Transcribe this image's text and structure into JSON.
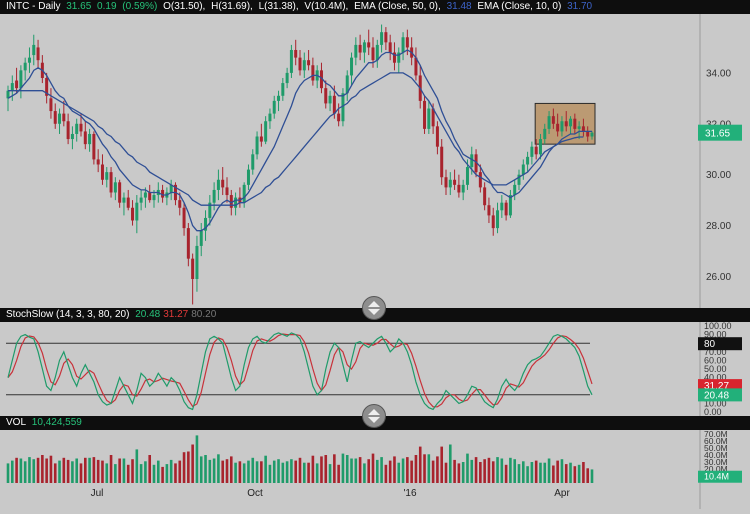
{
  "header": {
    "symbol": "INTC - Daily",
    "last": "31.65",
    "change": "0.19",
    "change_pct": "(0.59%)",
    "open": "O(31.50),",
    "high": "H(31.69),",
    "low": "L(31.38),",
    "volume": "V(10.4M),",
    "ema50_label": "EMA (Close, 50, 0),",
    "ema50_value": "31.48",
    "ema10_label": "EMA (Close, 10, 0)",
    "ema10_value": "31.70"
  },
  "stoch_header": {
    "label": "StochSlow (14, 3, 3, 80, 20)",
    "k_value": "20.48",
    "d_value": "31.27",
    "level_value": "80.20"
  },
  "vol_header": {
    "label": "VOL",
    "value": "10,424,559"
  },
  "colors": {
    "background": "#c9c9c9",
    "up_candle": "#1f9b6a",
    "down_candle": "#a8232d",
    "ema": "#2f4f95",
    "highlight": "#b58a55",
    "stoch_k": "#1f9b6a",
    "stoch_d": "#c8323a",
    "price_badge": "#22b07a",
    "d_badge": "#d8242e"
  },
  "price_axis": {
    "ticks": [
      "34.00",
      "32.00",
      "30.00",
      "28.00",
      "26.00"
    ],
    "badge": "31.65"
  },
  "stoch_axis": {
    "ticks": [
      "100.00",
      "90.00",
      "80.00",
      "70.00",
      "60.00",
      "50.00",
      "40.00",
      "30.00",
      "20.00",
      "10.00",
      "0.00"
    ],
    "badge_80": "80",
    "badge_d": "31.27",
    "badge_k": "20.48"
  },
  "vol_axis": {
    "ticks": [
      "70.0M",
      "60.0M",
      "50.0M",
      "40.0M",
      "30.0M",
      "20.0M",
      "10.0M"
    ],
    "badge": "10.4M"
  },
  "x_axis": {
    "ticks": [
      "Jul",
      "Oct",
      "'16",
      "Apr"
    ]
  },
  "chart_data": {
    "type": "candlestick",
    "title": "INTC - Daily",
    "ylim": [
      24.8,
      36.0
    ],
    "ohlc": [
      [
        33.0,
        33.5,
        32.5,
        33.3
      ],
      [
        33.3,
        33.9,
        32.9,
        33.6
      ],
      [
        33.7,
        34.2,
        33.2,
        33.4
      ],
      [
        33.4,
        34.3,
        33.0,
        34.1
      ],
      [
        34.1,
        34.6,
        33.7,
        34.4
      ],
      [
        34.4,
        35.0,
        34.0,
        34.6
      ],
      [
        34.7,
        35.5,
        34.3,
        35.1
      ],
      [
        35.0,
        35.3,
        34.2,
        34.5
      ],
      [
        34.4,
        34.7,
        33.6,
        33.8
      ],
      [
        33.8,
        34.0,
        32.8,
        33.1
      ],
      [
        33.0,
        33.4,
        32.2,
        32.5
      ],
      [
        32.5,
        32.8,
        31.8,
        32.0
      ],
      [
        32.0,
        32.6,
        31.6,
        32.4
      ],
      [
        32.4,
        32.9,
        31.9,
        32.1
      ],
      [
        32.1,
        32.4,
        31.2,
        31.4
      ],
      [
        31.4,
        31.9,
        31.0,
        31.6
      ],
      [
        31.6,
        32.2,
        31.3,
        32.0
      ],
      [
        32.0,
        32.4,
        31.5,
        31.7
      ],
      [
        31.7,
        32.1,
        31.0,
        31.2
      ],
      [
        31.2,
        31.8,
        30.9,
        31.6
      ],
      [
        31.6,
        31.7,
        30.4,
        30.6
      ],
      [
        30.6,
        31.0,
        30.1,
        30.4
      ],
      [
        30.4,
        30.8,
        29.6,
        29.8
      ],
      [
        29.8,
        30.3,
        29.5,
        30.1
      ],
      [
        30.1,
        30.3,
        29.1,
        29.3
      ],
      [
        29.3,
        29.9,
        29.0,
        29.7
      ],
      [
        29.7,
        29.8,
        28.7,
        28.9
      ],
      [
        28.9,
        29.3,
        28.4,
        29.1
      ],
      [
        29.1,
        29.4,
        28.6,
        28.7
      ],
      [
        28.7,
        29.0,
        28.0,
        28.2
      ],
      [
        28.2,
        29.2,
        27.7,
        28.9
      ],
      [
        28.9,
        29.4,
        28.6,
        29.1
      ],
      [
        29.1,
        29.5,
        28.7,
        29.3
      ],
      [
        29.3,
        29.6,
        28.9,
        29.0
      ],
      [
        29.0,
        29.4,
        28.7,
        29.2
      ],
      [
        29.2,
        29.7,
        28.9,
        29.4
      ],
      [
        29.4,
        29.6,
        28.9,
        29.1
      ],
      [
        29.1,
        29.5,
        28.8,
        29.3
      ],
      [
        29.3,
        29.8,
        29.0,
        29.6
      ],
      [
        29.6,
        29.7,
        28.8,
        29.0
      ],
      [
        29.0,
        29.3,
        28.4,
        28.7
      ],
      [
        28.7,
        28.9,
        27.6,
        27.9
      ],
      [
        27.9,
        28.1,
        26.4,
        26.7
      ],
      [
        26.7,
        26.9,
        24.9,
        25.9
      ],
      [
        25.9,
        27.6,
        25.4,
        27.2
      ],
      [
        27.2,
        28.1,
        26.8,
        27.8
      ],
      [
        27.8,
        28.6,
        27.4,
        28.3
      ],
      [
        28.3,
        29.2,
        28.0,
        28.9
      ],
      [
        28.9,
        29.7,
        28.6,
        29.4
      ],
      [
        29.4,
        30.2,
        29.0,
        29.8
      ],
      [
        29.8,
        30.3,
        29.2,
        29.5
      ],
      [
        29.5,
        29.9,
        28.9,
        29.2
      ],
      [
        29.2,
        29.4,
        28.4,
        28.7
      ],
      [
        28.7,
        29.3,
        28.4,
        29.1
      ],
      [
        29.1,
        29.5,
        28.7,
        28.9
      ],
      [
        28.9,
        29.7,
        28.7,
        29.6
      ],
      [
        29.6,
        30.4,
        29.4,
        30.2
      ],
      [
        30.2,
        31.0,
        30.0,
        30.8
      ],
      [
        30.8,
        31.7,
        30.6,
        31.5
      ],
      [
        31.5,
        32.0,
        31.1,
        31.3
      ],
      [
        31.3,
        32.3,
        31.2,
        32.1
      ],
      [
        32.1,
        32.6,
        31.8,
        32.4
      ],
      [
        32.4,
        33.1,
        32.2,
        32.9
      ],
      [
        32.9,
        33.3,
        32.5,
        33.1
      ],
      [
        33.1,
        33.8,
        32.9,
        33.6
      ],
      [
        33.6,
        34.2,
        33.4,
        34.0
      ],
      [
        34.0,
        35.1,
        33.8,
        34.9
      ],
      [
        34.9,
        35.3,
        34.3,
        34.6
      ],
      [
        34.6,
        34.9,
        33.9,
        34.1
      ],
      [
        34.1,
        34.8,
        33.8,
        34.5
      ],
      [
        34.5,
        34.9,
        34.1,
        34.3
      ],
      [
        34.3,
        34.6,
        33.5,
        33.7
      ],
      [
        33.7,
        34.3,
        33.4,
        34.1
      ],
      [
        34.1,
        34.4,
        33.2,
        33.4
      ],
      [
        33.4,
        33.7,
        32.6,
        32.8
      ],
      [
        32.8,
        33.3,
        32.5,
        33.1
      ],
      [
        33.1,
        33.5,
        32.2,
        32.4
      ],
      [
        32.4,
        32.8,
        31.9,
        32.1
      ],
      [
        32.1,
        33.4,
        31.9,
        33.2
      ],
      [
        33.2,
        34.1,
        32.9,
        33.9
      ],
      [
        33.9,
        34.8,
        33.5,
        34.6
      ],
      [
        34.6,
        35.4,
        34.3,
        35.1
      ],
      [
        35.1,
        35.5,
        34.5,
        34.8
      ],
      [
        34.8,
        35.3,
        34.4,
        35.2
      ],
      [
        35.2,
        35.7,
        34.7,
        35.0
      ],
      [
        35.0,
        35.4,
        34.2,
        34.5
      ],
      [
        34.5,
        35.3,
        34.2,
        35.1
      ],
      [
        35.1,
        35.9,
        34.8,
        35.6
      ],
      [
        35.6,
        35.8,
        34.9,
        35.2
      ],
      [
        35.2,
        35.5,
        34.5,
        34.8
      ],
      [
        34.8,
        35.2,
        34.1,
        34.4
      ],
      [
        34.4,
        35.0,
        34.0,
        34.8
      ],
      [
        34.8,
        35.6,
        34.5,
        35.4
      ],
      [
        35.4,
        35.7,
        34.7,
        35.0
      ],
      [
        35.0,
        35.4,
        34.3,
        34.6
      ],
      [
        34.6,
        35.0,
        33.7,
        33.9
      ],
      [
        33.9,
        34.3,
        32.6,
        32.9
      ],
      [
        32.9,
        33.1,
        31.6,
        31.8
      ],
      [
        31.8,
        32.9,
        31.6,
        32.6
      ],
      [
        32.6,
        32.8,
        31.6,
        31.9
      ],
      [
        31.9,
        32.1,
        30.8,
        31.1
      ],
      [
        31.1,
        31.4,
        29.6,
        29.9
      ],
      [
        29.9,
        30.2,
        29.2,
        29.5
      ],
      [
        29.5,
        30.1,
        29.2,
        29.8
      ],
      [
        29.8,
        30.2,
        29.4,
        29.6
      ],
      [
        29.6,
        30.0,
        29.1,
        29.3
      ],
      [
        29.3,
        29.8,
        29.0,
        29.6
      ],
      [
        29.6,
        30.6,
        29.4,
        30.3
      ],
      [
        30.3,
        31.1,
        30.0,
        30.8
      ],
      [
        30.8,
        31.0,
        29.9,
        30.1
      ],
      [
        30.1,
        30.4,
        29.3,
        29.5
      ],
      [
        29.5,
        29.7,
        28.6,
        28.8
      ],
      [
        28.8,
        29.1,
        28.1,
        28.4
      ],
      [
        28.4,
        28.7,
        27.6,
        27.9
      ],
      [
        27.9,
        28.9,
        27.7,
        28.6
      ],
      [
        28.6,
        29.2,
        28.3,
        28.9
      ],
      [
        28.9,
        29.0,
        28.2,
        28.4
      ],
      [
        28.4,
        29.4,
        28.3,
        29.2
      ],
      [
        29.2,
        29.8,
        29.0,
        29.6
      ],
      [
        29.6,
        30.2,
        29.4,
        30.0
      ],
      [
        30.0,
        30.6,
        29.8,
        30.4
      ],
      [
        30.4,
        30.9,
        30.1,
        30.7
      ],
      [
        30.7,
        31.3,
        30.4,
        31.1
      ],
      [
        31.1,
        31.4,
        30.6,
        30.8
      ],
      [
        30.8,
        31.6,
        30.6,
        31.4
      ],
      [
        31.4,
        32.0,
        31.2,
        31.8
      ],
      [
        31.8,
        32.5,
        31.6,
        32.3
      ],
      [
        32.3,
        32.6,
        31.8,
        32.0
      ],
      [
        32.0,
        32.4,
        31.5,
        31.7
      ],
      [
        31.7,
        32.3,
        31.5,
        32.1
      ],
      [
        32.1,
        32.5,
        31.7,
        31.9
      ],
      [
        31.9,
        32.3,
        31.6,
        32.2
      ],
      [
        32.2,
        32.4,
        31.6,
        31.8
      ],
      [
        31.8,
        32.1,
        31.4,
        31.9
      ],
      [
        31.9,
        32.2,
        31.5,
        31.7
      ],
      [
        31.7,
        31.9,
        31.3,
        31.5
      ],
      [
        31.5,
        31.7,
        31.38,
        31.65
      ]
    ],
    "ema10": [
      33.0,
      33.1,
      33.2,
      33.4,
      33.6,
      33.8,
      34.1,
      34.2,
      34.1,
      33.9,
      33.6,
      33.3,
      33.1,
      33.0,
      32.7,
      32.5,
      32.4,
      32.3,
      32.1,
      32.0,
      31.8,
      31.5,
      31.2,
      31.0,
      30.7,
      30.5,
      30.2,
      30.0,
      29.8,
      29.6,
      29.5,
      29.4,
      29.4,
      29.3,
      29.3,
      29.3,
      29.2,
      29.2,
      29.3,
      29.3,
      29.2,
      28.9,
      28.5,
      28.0,
      27.8,
      27.8,
      27.9,
      28.1,
      28.4,
      28.7,
      28.9,
      29.0,
      28.9,
      29.0,
      29.0,
      29.1,
      29.3,
      29.6,
      29.9,
      30.2,
      30.5,
      30.8,
      31.1,
      31.5,
      31.9,
      32.3,
      32.7,
      33.2,
      33.5,
      33.7,
      33.8,
      33.9,
      33.9,
      33.8,
      33.6,
      33.5,
      33.3,
      33.1,
      33.1,
      33.2,
      33.5,
      33.8,
      34.0,
      34.2,
      34.4,
      34.4,
      34.5,
      34.7,
      34.8,
      34.8,
      34.7,
      34.7,
      34.8,
      34.9,
      34.8,
      34.6,
      34.3,
      33.9,
      33.6,
      33.3,
      33.0,
      32.5,
      32.1,
      31.8,
      31.4,
      31.1,
      30.8,
      30.7,
      30.6,
      30.5,
      30.3,
      30.0,
      29.8,
      29.5,
      29.3,
      29.3,
      29.2,
      29.1,
      29.2,
      29.3,
      29.5,
      29.7,
      29.9,
      30.1,
      30.3,
      30.6,
      30.9,
      31.1,
      31.2,
      31.4,
      31.5,
      31.6,
      31.6,
      31.7,
      31.7,
      31.7,
      31.7
    ],
    "ema50": [
      33.3,
      33.3,
      33.3,
      33.3,
      33.3,
      33.3,
      33.3,
      33.3,
      33.3,
      33.2,
      33.1,
      33.0,
      32.9,
      32.8,
      32.7,
      32.6,
      32.5,
      32.4,
      32.3,
      32.2,
      32.1,
      31.9,
      31.8,
      31.6,
      31.5,
      31.3,
      31.2,
      31.0,
      30.8,
      30.7,
      30.5,
      30.4,
      30.3,
      30.1,
      30.0,
      29.9,
      29.8,
      29.7,
      29.6,
      29.5,
      29.4,
      29.3,
      29.2,
      29.0,
      28.9,
      28.8,
      28.8,
      28.8,
      28.8,
      28.8,
      28.8,
      28.8,
      28.8,
      28.8,
      28.9,
      28.9,
      29.0,
      29.1,
      29.2,
      29.3,
      29.5,
      29.6,
      29.8,
      29.9,
      30.1,
      30.3,
      30.5,
      30.7,
      30.9,
      31.1,
      31.3,
      31.5,
      31.7,
      31.9,
      32.1,
      32.3,
      32.4,
      32.6,
      32.7,
      32.8,
      33.0,
      33.1,
      33.3,
      33.4,
      33.5,
      33.6,
      33.7,
      33.8,
      33.9,
      34.0,
      34.0,
      34.0,
      34.0,
      33.9,
      33.8,
      33.6,
      33.4,
      33.1,
      32.9,
      32.6,
      32.3,
      32.0,
      31.7,
      31.4,
      31.1,
      30.9,
      30.6,
      30.4,
      30.2,
      30.0,
      29.9,
      29.8,
      29.7,
      29.6,
      29.6,
      29.6,
      29.6,
      29.7,
      29.8,
      29.9,
      30.0,
      30.1,
      30.3,
      30.5,
      30.7,
      30.9,
      31.0,
      31.1,
      31.2,
      31.3,
      31.35,
      31.4,
      31.45,
      31.48,
      31.48
    ],
    "highlight_box": {
      "start_index": 123,
      "end_index": 136,
      "low": 31.2,
      "high": 32.8
    },
    "stoch_k": [
      40,
      60,
      80,
      88,
      90,
      87,
      85,
      70,
      50,
      30,
      25,
      40,
      60,
      70,
      55,
      40,
      30,
      45,
      55,
      45,
      35,
      20,
      12,
      8,
      10,
      25,
      40,
      30,
      20,
      10,
      25,
      45,
      40,
      30,
      35,
      45,
      38,
      30,
      40,
      35,
      25,
      12,
      5,
      3,
      20,
      45,
      70,
      85,
      88,
      85,
      80,
      60,
      40,
      25,
      30,
      55,
      75,
      85,
      88,
      82,
      80,
      85,
      90,
      92,
      90,
      88,
      92,
      90,
      85,
      70,
      50,
      30,
      20,
      25,
      50,
      70,
      80,
      75,
      55,
      35,
      60,
      80,
      82,
      78,
      75,
      80,
      85,
      88,
      80,
      70,
      75,
      85,
      80,
      70,
      55,
      35,
      20,
      10,
      5,
      3,
      10,
      15,
      25,
      20,
      15,
      10,
      12,
      20,
      30,
      28,
      20,
      12,
      8,
      5,
      15,
      30,
      38,
      30,
      25,
      32,
      45,
      55,
      60,
      62,
      65,
      72,
      80,
      88,
      90,
      88,
      85,
      80,
      75,
      65,
      48,
      30,
      20
    ]
  }
}
